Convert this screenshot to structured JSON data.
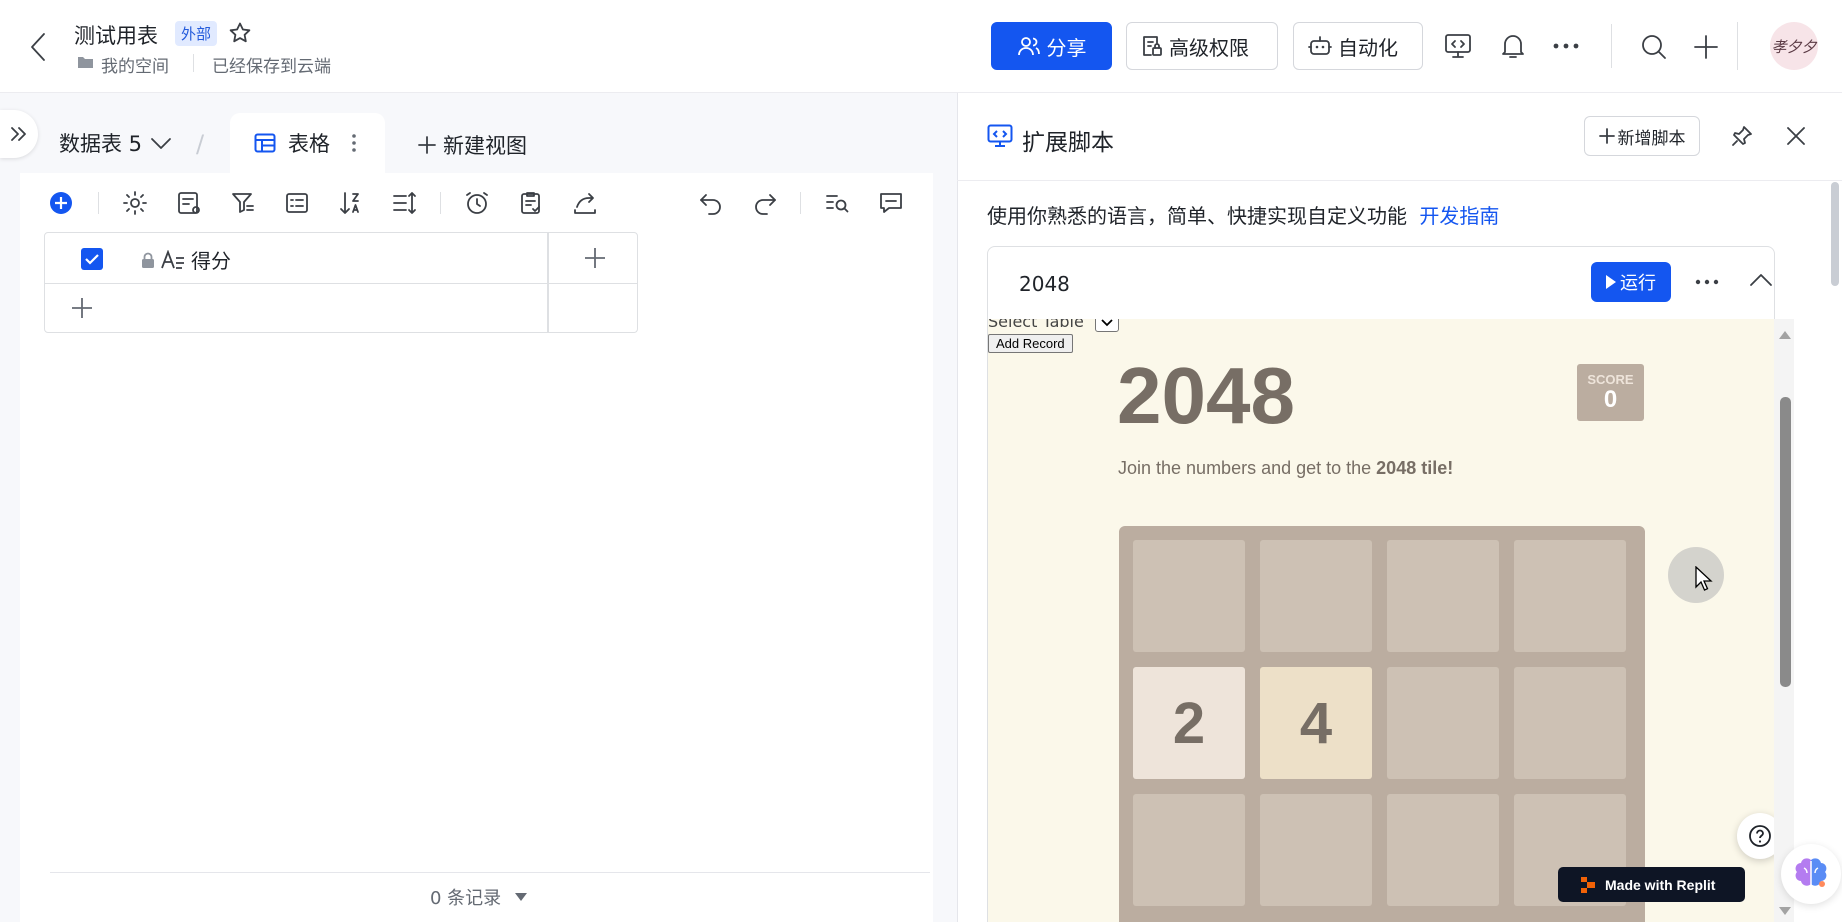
{
  "header": {
    "title": "测试用表",
    "external_badge": "外部",
    "breadcrumb_space": "我的空间",
    "save_status": "已经保存到云端",
    "share_label": "分享",
    "permissions_label": "高级权限",
    "automation_label": "自动化",
    "avatar_text": "孝夕夕"
  },
  "sheet": {
    "table_name": "数据表 5",
    "view_tab": "表格",
    "new_view": "新建视图",
    "column_name": "得分",
    "record_count": "0 条记录"
  },
  "extension": {
    "title": "扩展脚本",
    "add_script": "新增脚本",
    "description": "使用你熟悉的语言，简单、快捷实现自定义功能",
    "guide_link": "开发指南",
    "script_name": "2048",
    "run_label": "运行"
  },
  "game": {
    "select_table_label": "Select Table",
    "add_record_label": "Add Record",
    "title": "2048",
    "score_label": "SCORE",
    "score_value": "0",
    "intro_text": "Join the numbers and get to the ",
    "intro_bold": "2048 tile!",
    "tiles": [
      [
        "",
        "",
        "",
        ""
      ],
      [
        "2",
        "4",
        "",
        ""
      ],
      [
        "",
        "",
        "",
        ""
      ]
    ],
    "made_with": "Made with Replit"
  },
  "colors": {
    "primary": "#1456f0",
    "tile_2": "#eee4da",
    "tile_4": "#ede0c8",
    "tile_empty": "#cdc1b4",
    "board": "#bbada0",
    "game_bg": "#fbf8ea"
  }
}
